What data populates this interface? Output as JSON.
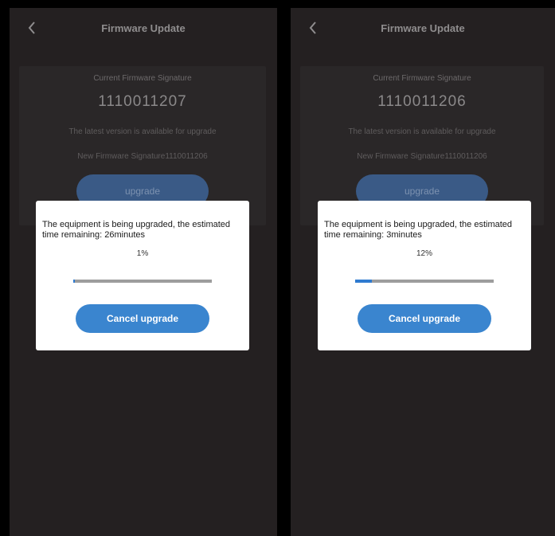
{
  "screens": [
    {
      "header": {
        "title": "Firmware Update",
        "back_icon": "chevron-left-icon"
      },
      "card": {
        "current_label": "Current Firmware Signature",
        "current_value": "1110011207",
        "latest_text": "The latest version is available for upgrade",
        "new_signature": "New Firmware Signature1110011206",
        "upgrade_label": "upgrade"
      },
      "modal": {
        "message": "The equipment is being upgraded, the estimated time remaining: 26minutes",
        "percent_text": "1%",
        "progress": 0.01,
        "cancel_label": "Cancel upgrade"
      }
    },
    {
      "header": {
        "title": "Firmware Update",
        "back_icon": "chevron-left-icon"
      },
      "card": {
        "current_label": "Current Firmware Signature",
        "current_value": "1110011206",
        "latest_text": "The latest version is available for upgrade",
        "new_signature": "New Firmware Signature1110011206",
        "upgrade_label": "upgrade"
      },
      "modal": {
        "message": "The equipment is being upgraded, the estimated time remaining: 3minutes",
        "percent_text": "12%",
        "progress": 0.12,
        "cancel_label": "Cancel upgrade"
      }
    }
  ],
  "colors": {
    "background": "#242021",
    "accent": "#3a85cf",
    "progress_fill": "#2f7bd0",
    "progress_track": "#9d9d9d"
  }
}
